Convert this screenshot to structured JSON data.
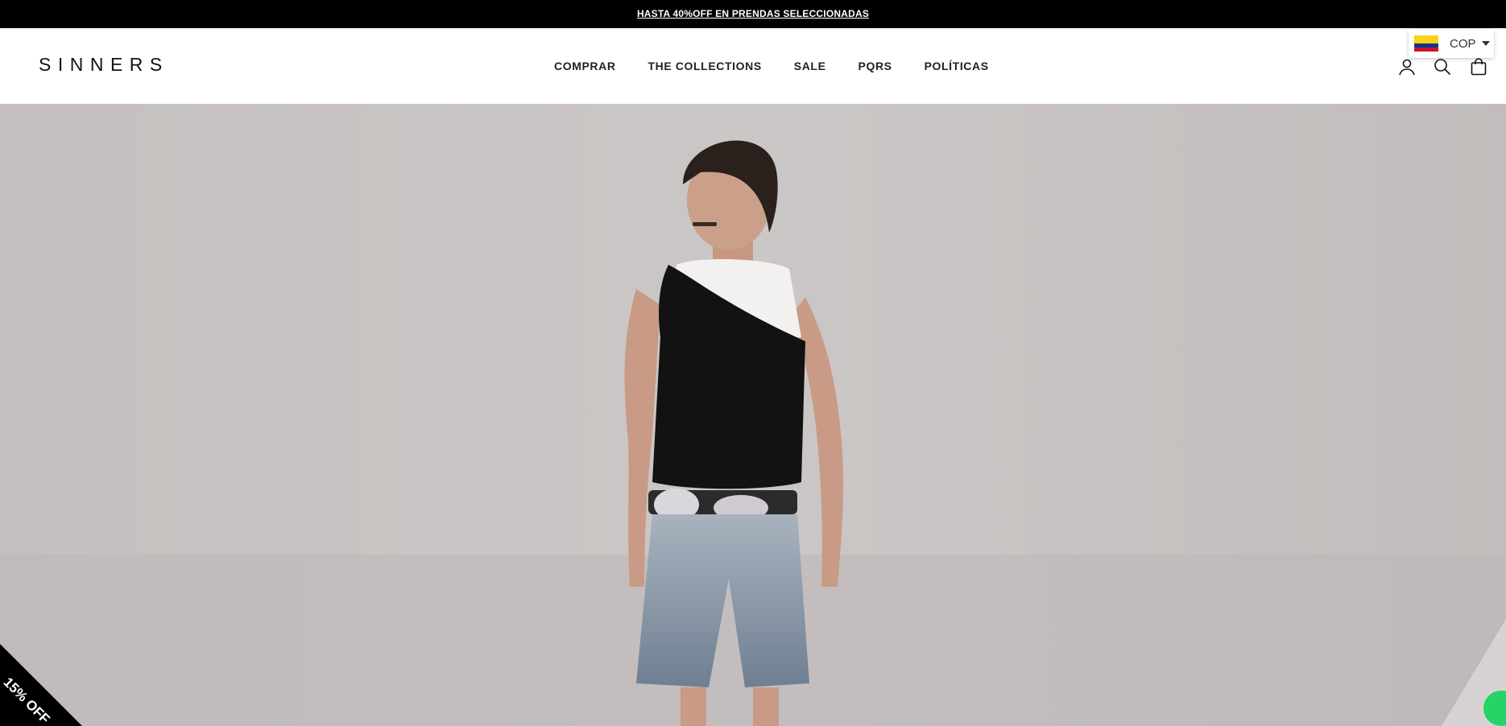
{
  "announcement": {
    "text": "HASTA 40%OFF EN PRENDAS SELECCIONADAS"
  },
  "header": {
    "logo": "SINNERS",
    "nav": [
      "COMPRAR",
      "THE COLLECTIONS",
      "SALE",
      "PQRS",
      "POLÍTICAS"
    ],
    "icons": [
      "account-icon",
      "search-icon",
      "cart-icon"
    ]
  },
  "currency": {
    "code": "COP",
    "flag_icon": "colombia-flag-icon"
  },
  "promo_badge": {
    "text": "15% OFF"
  },
  "floating": {
    "icon": "whatsapp-icon",
    "color": "#25D366"
  },
  "colors": {
    "bar": "#000000",
    "hero_bg": "#c6c2c1"
  }
}
